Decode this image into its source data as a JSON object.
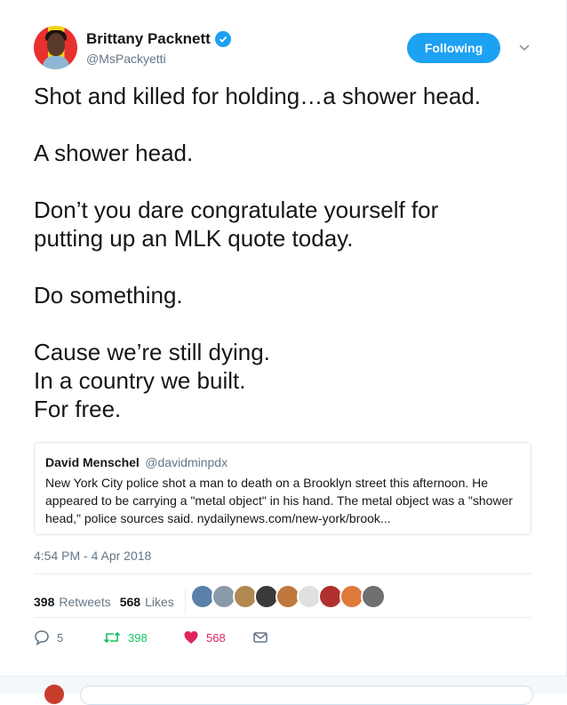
{
  "author": {
    "name": "Brittany Packnett",
    "handle": "@MsPackyetti",
    "verified": true,
    "follow_label": "Following"
  },
  "tweet": {
    "paragraphs": [
      [
        "Shot and killed for holding…a shower head."
      ],
      [
        "A shower head."
      ],
      [
        "Don’t you dare congratulate yourself for",
        "putting up an MLK quote today."
      ],
      [
        "Do something."
      ],
      [
        "Cause we’re still dying.",
        "In a country we built.",
        "For free."
      ]
    ]
  },
  "quoted": {
    "name": "David Menschel",
    "handle": "@davidminpdx",
    "text": "New York City police shot a man to death on a Brooklyn street this afternoon. He appeared to be carrying a \"metal object\" in his hand. The metal object was a \"shower head,\" police sources said. nydailynews.com/new-york/brook..."
  },
  "timestamp": "4:54 PM - 4 Apr 2018",
  "stats": {
    "retweets_count": "398",
    "retweets_label": "Retweets",
    "likes_count": "568",
    "likes_label": "Likes"
  },
  "liker_avatars": [
    "#5a7fa8",
    "#8a9aa8",
    "#b08850",
    "#3a3a3a",
    "#c0783c",
    "#e0e0e0",
    "#b03030",
    "#e07a3a",
    "#707070"
  ],
  "actions": {
    "replies": "5",
    "retweets": "398",
    "likes": "568"
  },
  "colors": {
    "accent": "#1da1f2",
    "retweet": "#17bf63",
    "like": "#e0245e",
    "muted": "#657786"
  }
}
